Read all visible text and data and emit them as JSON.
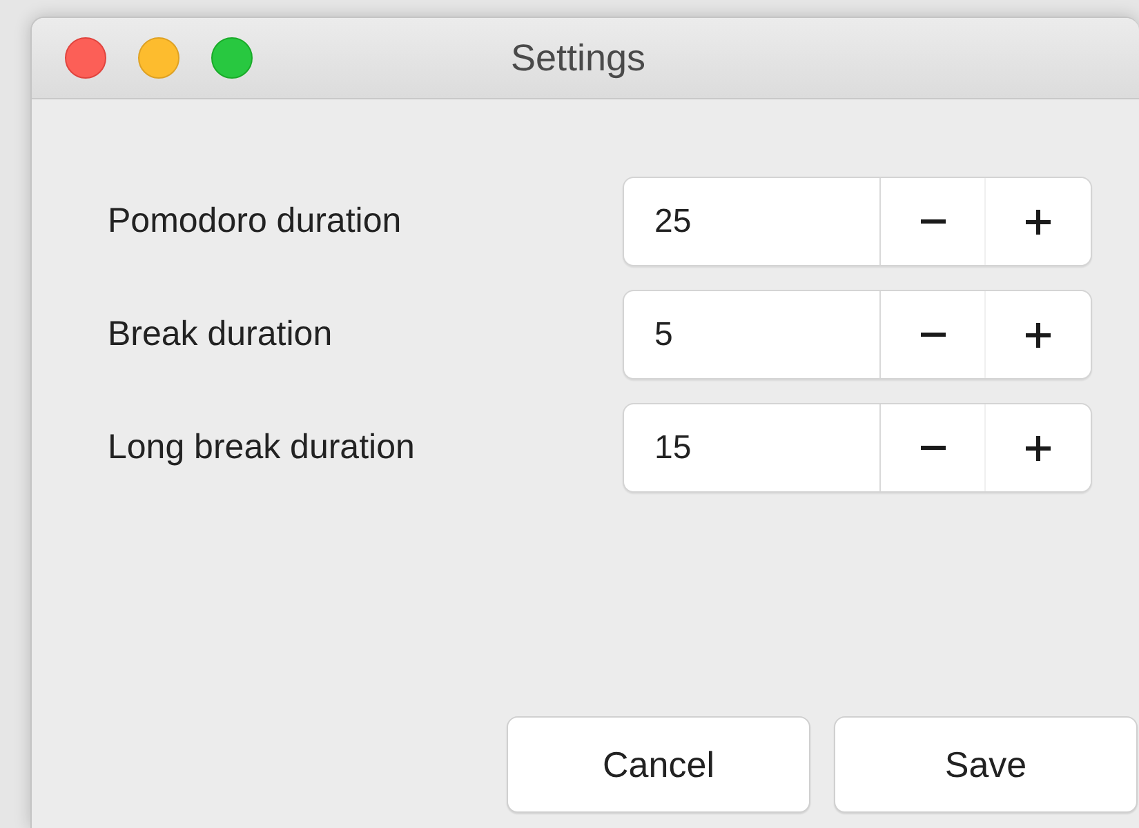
{
  "window": {
    "title": "Settings"
  },
  "settings": [
    {
      "label": "Pomodoro duration",
      "value": "25"
    },
    {
      "label": "Break duration",
      "value": "5"
    },
    {
      "label": "Long break duration",
      "value": "15"
    }
  ],
  "buttons": [
    "Cancel",
    "Save"
  ]
}
